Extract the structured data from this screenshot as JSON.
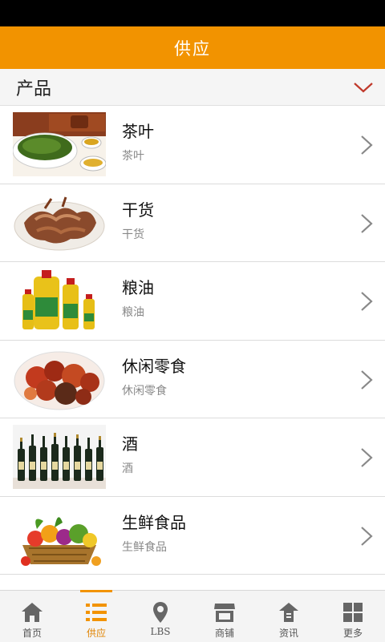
{
  "header": {
    "title": "供应"
  },
  "category": {
    "label": "产品",
    "chevron_icon": "chevron-down-icon",
    "accent": "#c0392b"
  },
  "items": [
    {
      "title": "茶叶",
      "subtitle": "茶叶",
      "image": "tea-image"
    },
    {
      "title": "干货",
      "subtitle": "干货",
      "image": "dried-food-image"
    },
    {
      "title": "粮油",
      "subtitle": "粮油",
      "image": "cooking-oil-image"
    },
    {
      "title": "休闲零食",
      "subtitle": "休闲零食",
      "image": "snacks-image"
    },
    {
      "title": "酒",
      "subtitle": "酒",
      "image": "wine-image"
    },
    {
      "title": "生鲜食品",
      "subtitle": "生鲜食品",
      "image": "fresh-produce-image"
    }
  ],
  "tabs": [
    {
      "label": "首页",
      "icon": "home-icon"
    },
    {
      "label": "供应",
      "icon": "list-icon",
      "active": true
    },
    {
      "label": "LBS",
      "icon": "location-pin-icon"
    },
    {
      "label": "商铺",
      "icon": "store-icon"
    },
    {
      "label": "资讯",
      "icon": "news-icon"
    },
    {
      "label": "更多",
      "icon": "grid-icon"
    }
  ],
  "colors": {
    "brand": "#f29300",
    "active_tab": "#e08300"
  }
}
